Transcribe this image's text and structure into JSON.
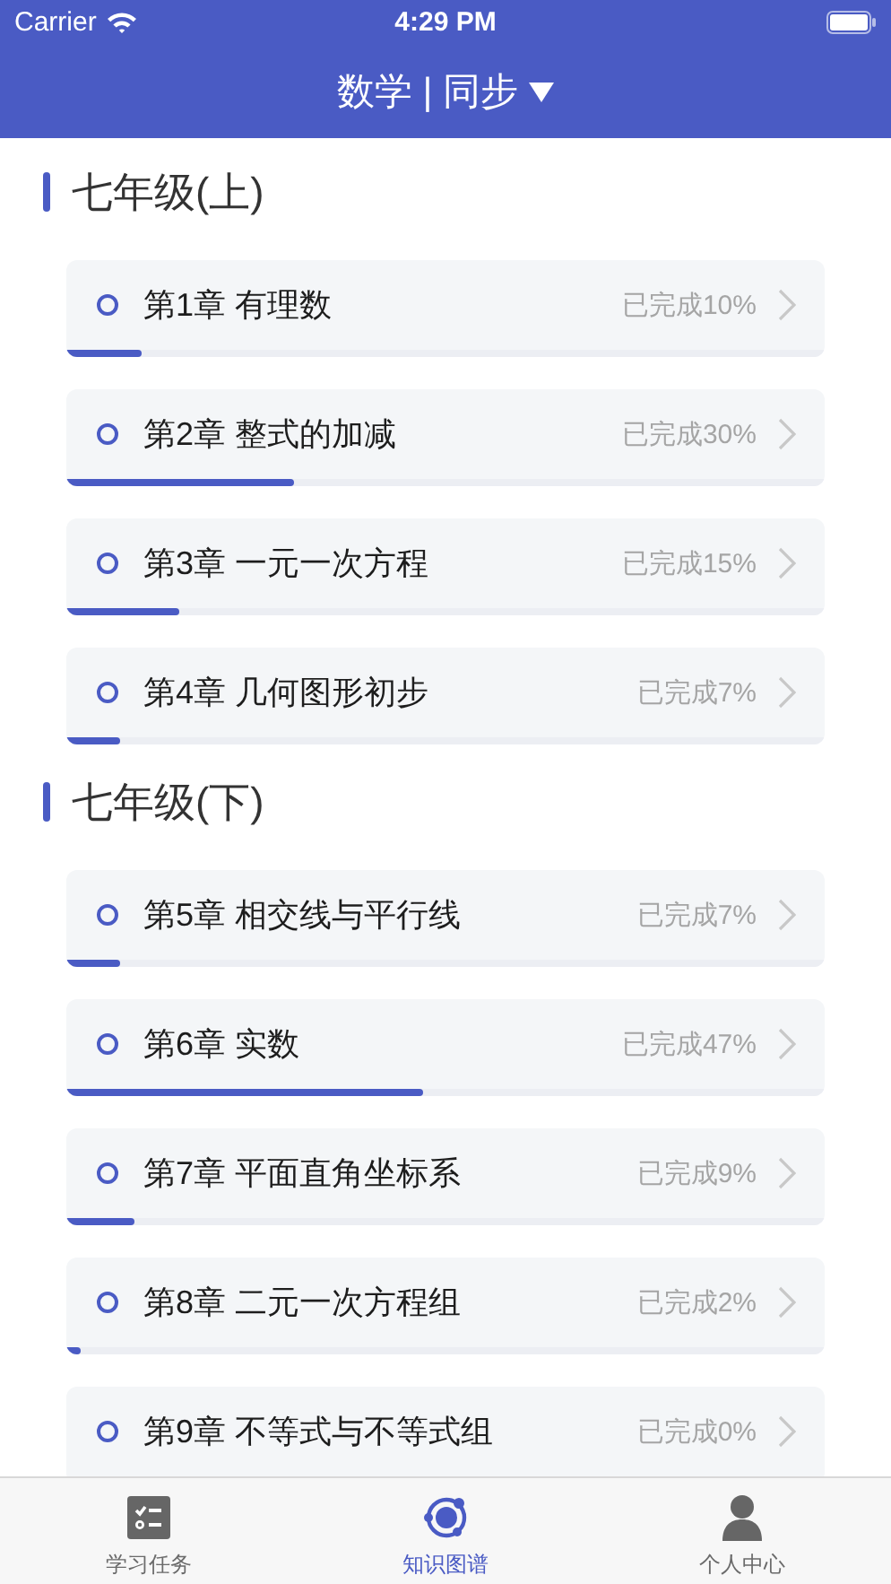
{
  "status_bar": {
    "carrier": "Carrier",
    "time": "4:29 PM"
  },
  "header": {
    "title": "数学 | 同步"
  },
  "sections": [
    {
      "title": "七年级(上)",
      "chapters": [
        {
          "title": "第1章 有理数",
          "status": "已完成10%",
          "level": 0.1
        },
        {
          "title": "第2章 整式的加减",
          "status": "已完成30%",
          "level": 0.3
        },
        {
          "title": "第3章 一元一次方程",
          "status": "已完成15%",
          "level": 0.15
        },
        {
          "title": "第4章 几何图形初步",
          "status": "已完成7%",
          "level": 0.07
        }
      ]
    },
    {
      "title": "七年级(下)",
      "chapters": [
        {
          "title": "第5章 相交线与平行线",
          "status": "已完成7%",
          "level": 0.07
        },
        {
          "title": "第6章 实数",
          "status": "已完成47%",
          "level": 0.47
        },
        {
          "title": "第7章 平面直角坐标系",
          "status": "已完成9%",
          "level": 0.09
        },
        {
          "title": "第8章 二元一次方程组",
          "status": "已完成2%",
          "level": 0.02
        },
        {
          "title": "第9章 不等式与不等式组",
          "status": "已完成0%"
        }
      ]
    }
  ],
  "tabs": [
    {
      "kind": "tasks",
      "label": "学习任务",
      "selected": false
    },
    {
      "kind": "graph",
      "label": "知识图谱",
      "selected": true
    },
    {
      "kind": "profile",
      "label": "个人中心",
      "selected": false
    }
  ]
}
